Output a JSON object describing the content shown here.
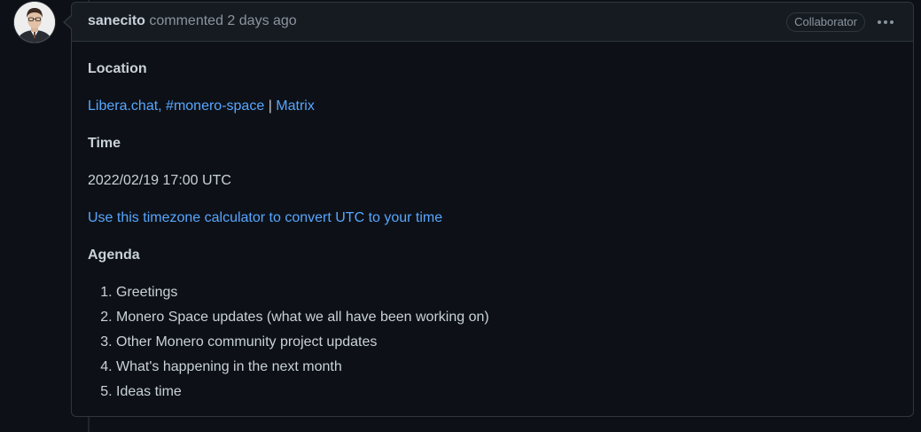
{
  "comment": {
    "author": "sanecito",
    "action_text": "commented",
    "time_text": "2 days ago",
    "badge": "Collaborator",
    "menu_icon": "kebab-horizontal-icon"
  },
  "body": {
    "location_heading": "Location",
    "location_link_1": "Libera.chat, #monero-space",
    "location_separator": "|",
    "location_link_2": "Matrix",
    "time_heading": "Time",
    "time_value": "2022/02/19 17:00 UTC",
    "timezone_link": "Use this timezone calculator to convert UTC to your time",
    "agenda_heading": "Agenda",
    "agenda_items": [
      "Greetings",
      "Monero Space updates (what we all have been working on)",
      "Other Monero community project updates",
      "What's happening in the next month",
      "Ideas time"
    ]
  },
  "colors": {
    "background": "#0d1117",
    "header_background": "#161b22",
    "border": "#30363d",
    "link": "#58a6ff",
    "text": "#c9d1d9",
    "muted": "#8b949e"
  }
}
